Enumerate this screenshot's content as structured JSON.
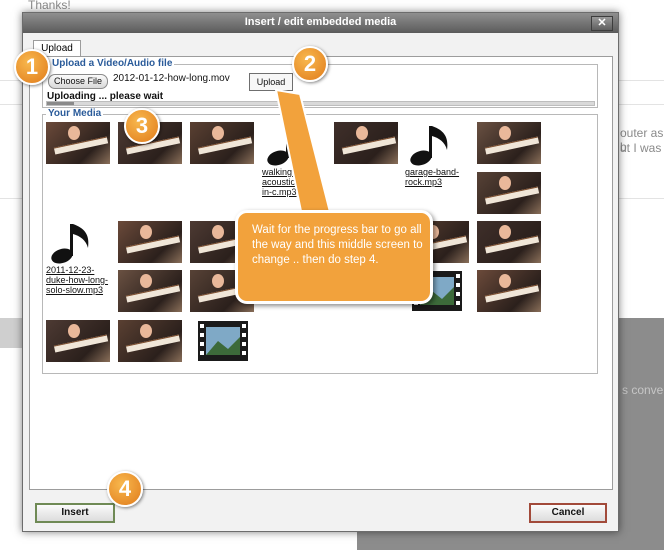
{
  "background": {
    "thanks_text": "Thanks!",
    "side_text_1": "outer as b",
    "side_text_2": "ut I was",
    "side_text_3": "s conve"
  },
  "dialog": {
    "title": "Insert / edit embedded media",
    "close_label": "✕",
    "tab_label": "Upload",
    "upload_legend": "Upload a Video/Audio file",
    "choose_file_label": "Choose File",
    "selected_file": "2012-01-12-how-long.mov",
    "upload_button": "Upload",
    "uploading_status": "Uploading ... please wait",
    "upload_progress": 0.05,
    "media_legend": "Your Media",
    "audio_files": [
      "walking-acoustic-blues-in-c.mp3",
      "garage-band-rock.mp3",
      "2011-12-23-duke-how-long-solo-slow.mp3"
    ],
    "insert_button": "Insert",
    "cancel_button": "Cancel"
  },
  "annotations": {
    "step1": "1",
    "step2": "2",
    "step3": "3",
    "step4": "4",
    "callout_text": "Wait for the progress bar to go all the way and this middle screen to change .. then do step 4."
  },
  "colors": {
    "accent_orange": "#f2a23c",
    "legend_blue": "#2a5b9a",
    "insert_border": "#6f8a55",
    "cancel_border": "#a24a3a"
  }
}
